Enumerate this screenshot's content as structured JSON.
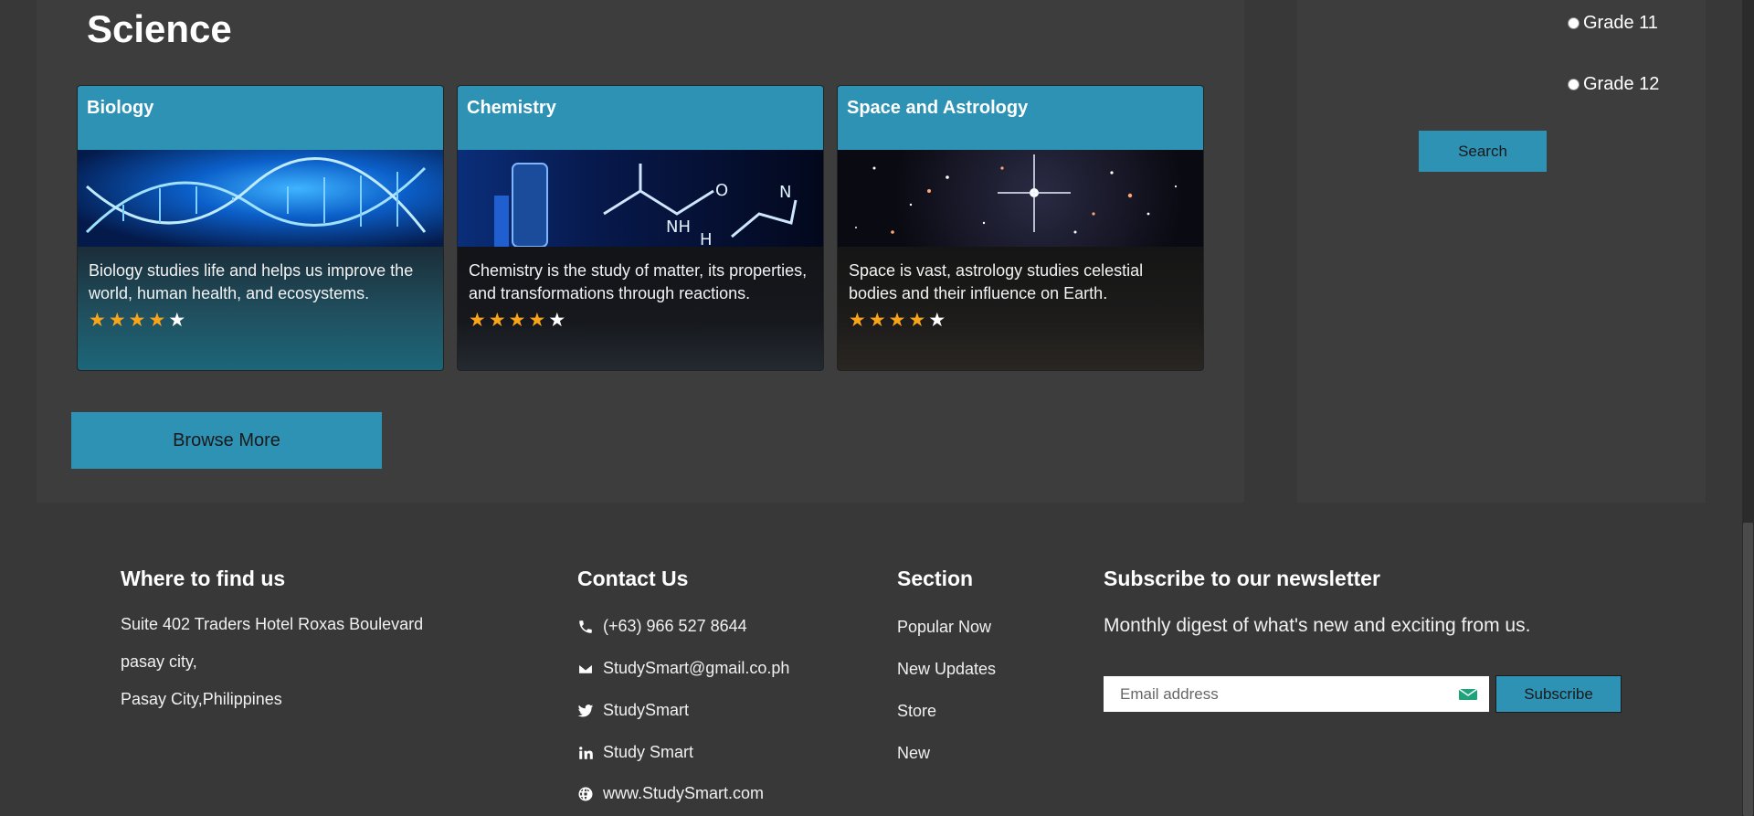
{
  "science": {
    "title": "Science",
    "cards": [
      {
        "title": "Biology",
        "description": "Biology studies life and helps us improve the world, human health, and ecosystems.",
        "rating": 4,
        "max_rating": 5
      },
      {
        "title": "Chemistry",
        "description": "Chemistry is the study of matter, its properties, and transformations through reactions.",
        "rating": 4,
        "max_rating": 5
      },
      {
        "title": "Space and Astrology",
        "description": "Space is vast, astrology studies celestial bodies and their influence on Earth.",
        "rating": 4,
        "max_rating": 5
      }
    ],
    "browse_more": "Browse More"
  },
  "sidebar": {
    "grades": [
      "Grade 11",
      "Grade 12"
    ],
    "search_label": "Search"
  },
  "footer": {
    "find_us": {
      "heading": "Where to find us",
      "lines": [
        "Suite 402 Traders Hotel Roxas Boulevard",
        "pasay city,",
        "Pasay City,Philippines"
      ]
    },
    "contact": {
      "heading": "Contact Us",
      "phone": "(+63) 966 527 8644",
      "email": "StudySmart@gmail.co.ph",
      "twitter": "StudySmart",
      "linkedin": "Study Smart",
      "website": "www.StudySmart.com"
    },
    "section": {
      "heading": "Section",
      "links": [
        "Popular Now",
        "New Updates",
        "Store",
        "New"
      ]
    },
    "newsletter": {
      "heading": "Subscribe to our newsletter",
      "description": "Monthly digest of what's new and exciting from us.",
      "email_placeholder": "Email address",
      "subscribe_label": "Subscribe"
    }
  },
  "colors": {
    "accent": "#2e92b4",
    "star_active": "#f9a51a",
    "page_bg": "#383838",
    "panel_bg": "#3d3d3d"
  }
}
